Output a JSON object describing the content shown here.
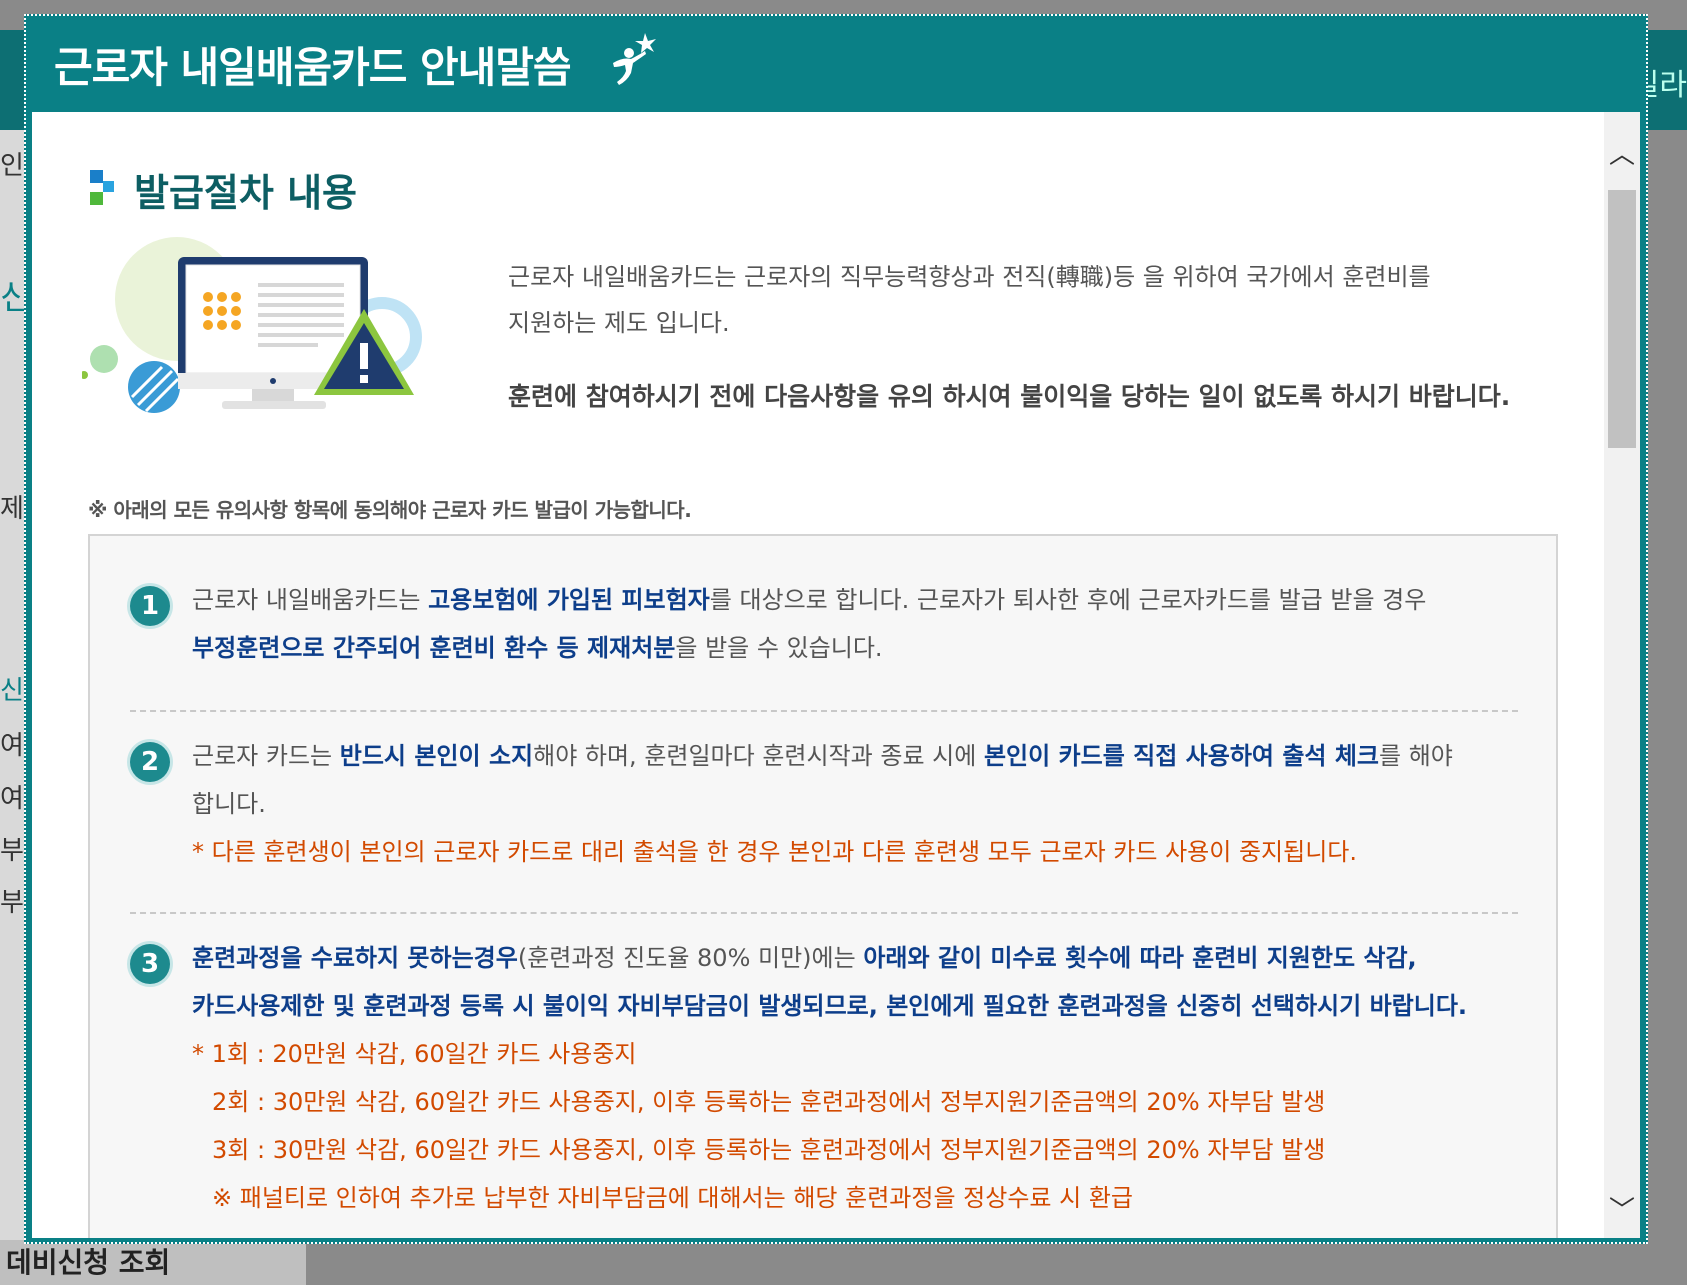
{
  "background": {
    "left_fragments": [
      "인",
      "신",
      "제",
      "신청",
      "여",
      "여",
      "부",
      "부"
    ],
    "bottom_text": "데비신청 조회",
    "right_fragment": "킬라"
  },
  "modal": {
    "title": "근로자 내일배움카드 안내말씀",
    "section_title": "발급절차 내용",
    "intro_line1": "근로자 내일배움카드는 근로자의 직무능력향상과 전직(轉職)등 을 위하여 국가에서 훈련비를",
    "intro_line2": "지원하는 제도 입니다.",
    "intro_strong": "훈련에 참여하시기 전에 다음사항을 유의 하시여 불이익을 당하는 일이 없도록 하시기 바랍니다.",
    "note": "※ 아래의 모든 유의사항 항목에 동의해야 근로자 카드 발급이 가능합니다.",
    "items": [
      {
        "num": "1",
        "t1": "근로자 내일배움카드는 ",
        "b1": "고용보험에 가입된 피보험자",
        "t2": "를 대상으로 합니다. 근로자가 퇴사한 후에 근로자카드를 발급 받을 경우",
        "b2": "부정훈련으로 간주되어 훈련비 환수 등 제재처분",
        "t3": "을 받을 수 있습니다."
      },
      {
        "num": "2",
        "t1": "근로자 카드는 ",
        "b1": "반드시 본인이 소지",
        "t2": "해야 하며, 훈련일마다 훈련시작과 종료 시에 ",
        "b2": "본인이 카드를 직접 사용하여 출석 체크",
        "t3": "를 해야",
        "t4": "합니다.",
        "warn": "* 다른 훈련생이 본인의 근로자 카드로 대리 출석을 한 경우 본인과 다른 훈련생 모두 근로자 카드 사용이 중지됩니다."
      },
      {
        "num": "3",
        "b1": "훈련과정을 수료하지 못하는경우",
        "t1": "(훈련과정 진도율 80% 미만)에는 ",
        "b2": "아래와 같이 미수료 횟수에 따라 훈련비 지원한도 삭감,",
        "b3": "카드사용제한 및 훈련과정 등록 시 불이익 자비부담금이 발생되므로, 본인에게 필요한 훈련과정을 신중히 선택하시기 바랍니다.",
        "p1": "* 1회 : 20만원 삭감, 60일간 카드 사용중지",
        "p2": "2회 : 30만원 삭감, 60일간 카드 사용중지, 이후 등록하는 훈련과정에서 정부지원기준금액의 20% 자부담 발생",
        "p3": "3회 : 30만원 삭감, 60일간 카드 사용중지, 이후 등록하는 훈련과정에서 정부지원기준금액의 20% 자부담 발생",
        "p4": "※ 패널티로 인하여 추가로 납부한 자비부담금에 대해서는 해당 훈련과정을 정상수료 시 환급"
      }
    ]
  },
  "colors": {
    "header_teal": "#0a8086",
    "emphasis_blue": "#0d3e8a",
    "warning_orange": "#d24a00"
  },
  "icons": [
    "sparkle-figure-icon",
    "section-bullet-icon",
    "scroll-up-icon",
    "scroll-down-icon",
    "monitor-warning-illustration"
  ]
}
